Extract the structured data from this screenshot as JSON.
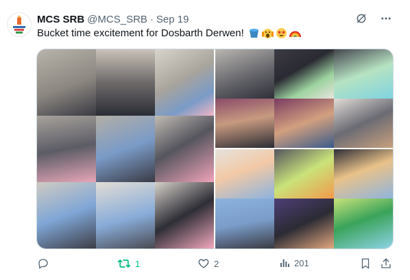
{
  "tweet": {
    "name": "MCS SRB",
    "handle": "@MCS_SRB",
    "separator": "·",
    "date": "Sep 19",
    "text": "Bucket time excitement for Dosbarth Derwen!",
    "emojis": [
      "bucket-emoji",
      "screaming-face-emoji",
      "star-struck-emoji",
      "rainbow-emoji"
    ],
    "media_alt": "Collage of photos of children doing bucket time activities"
  },
  "actions": {
    "reply_count": "",
    "retweet_count": "1",
    "like_count": "2",
    "views_count": "201"
  },
  "colors": {
    "text": "#0f1419",
    "muted": "#536471",
    "retweet_active": "#00ba7c",
    "border": "#cfd9de"
  }
}
